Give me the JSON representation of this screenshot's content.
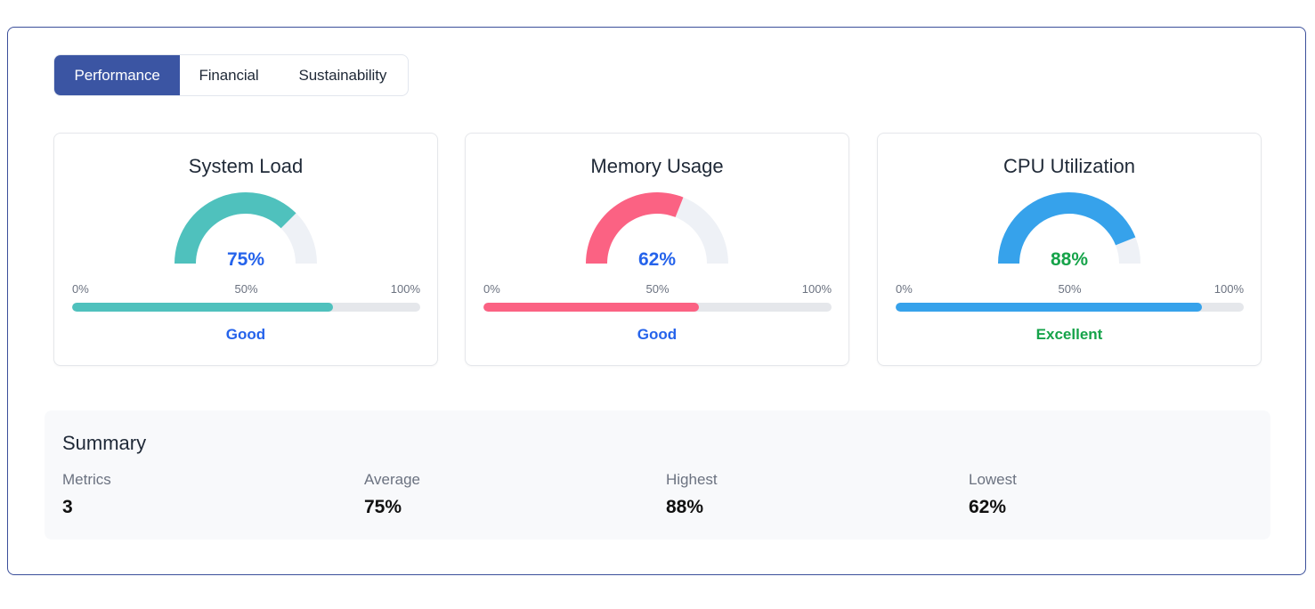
{
  "tabs": [
    {
      "label": "Performance",
      "active": true
    },
    {
      "label": "Financial",
      "active": false
    },
    {
      "label": "Sustainability",
      "active": false
    }
  ],
  "scale": {
    "min": "0%",
    "mid": "50%",
    "max": "100%"
  },
  "metrics": [
    {
      "title": "System Load",
      "value": 75,
      "value_text": "75%",
      "rating": "Good",
      "color": "#4fc1bd",
      "value_color": "#2563eb",
      "rating_color": "#2563eb"
    },
    {
      "title": "Memory Usage",
      "value": 62,
      "value_text": "62%",
      "rating": "Good",
      "color": "#fb6283",
      "value_color": "#2563eb",
      "rating_color": "#2563eb"
    },
    {
      "title": "CPU Utilization",
      "value": 88,
      "value_text": "88%",
      "rating": "Excellent",
      "color": "#36a2eb",
      "value_color": "#16a34a",
      "rating_color": "#16a34a"
    }
  ],
  "gauge_track_color": "#eef1f6",
  "summary": {
    "title": "Summary",
    "stats": [
      {
        "label": "Metrics",
        "value": "3"
      },
      {
        "label": "Average",
        "value": "75%"
      },
      {
        "label": "Highest",
        "value": "88%"
      },
      {
        "label": "Lowest",
        "value": "62%"
      }
    ]
  }
}
